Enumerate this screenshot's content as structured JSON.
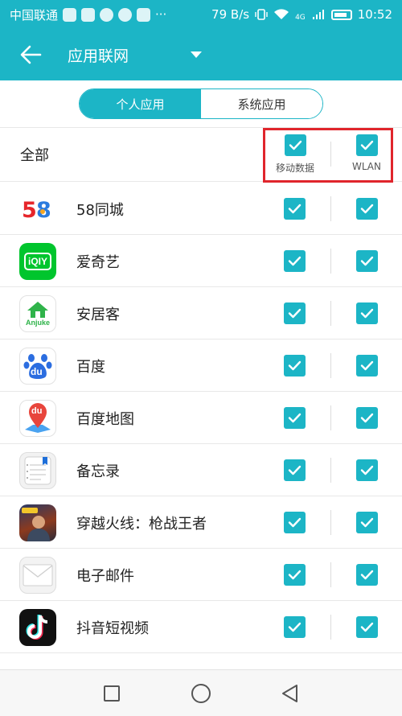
{
  "status_bar": {
    "carrier": "中国联通",
    "net_speed": "79 B/s",
    "signal_label": "4G",
    "time": "10:52",
    "more": "···"
  },
  "app_bar": {
    "title": "应用联网",
    "back_icon": "arrow-left-icon",
    "dropdown_icon": "triangle-down-icon"
  },
  "tabs": [
    {
      "label": "个人应用",
      "active": true
    },
    {
      "label": "系统应用",
      "active": false
    }
  ],
  "header": {
    "all_label": "全部",
    "mobile_data_label": "移动数据",
    "wlan_label": "WLAN",
    "mobile_checked": true,
    "wlan_checked": true
  },
  "apps": [
    {
      "name": "58同城",
      "icon": "58-tongcheng-icon",
      "mobile": true,
      "wlan": true
    },
    {
      "name": "爱奇艺",
      "icon": "iqiyi-icon",
      "icon_text": "iQIY",
      "mobile": true,
      "wlan": true
    },
    {
      "name": "安居客",
      "icon": "anjuke-icon",
      "icon_text": "Anjuke",
      "mobile": true,
      "wlan": true
    },
    {
      "name": "百度",
      "icon": "baidu-paw-icon",
      "icon_text": "du",
      "mobile": true,
      "wlan": true
    },
    {
      "name": "百度地图",
      "icon": "baidu-map-icon",
      "icon_text": "du",
      "mobile": true,
      "wlan": true
    },
    {
      "name": "备忘录",
      "icon": "memo-icon",
      "mobile": true,
      "wlan": true
    },
    {
      "name": "穿越火线：枪战王者",
      "icon": "crossfire-icon",
      "mobile": true,
      "wlan": true
    },
    {
      "name": "电子邮件",
      "icon": "email-icon",
      "mobile": true,
      "wlan": true
    },
    {
      "name": "抖音短视频",
      "icon": "douyin-icon",
      "mobile": true,
      "wlan": true
    }
  ],
  "nav_bar": {
    "buttons": [
      "recent-apps-square-icon",
      "home-circle-icon",
      "back-triangle-icon"
    ]
  },
  "colors": {
    "accent": "#1cb5c6",
    "highlight_border": "#e0252c"
  }
}
